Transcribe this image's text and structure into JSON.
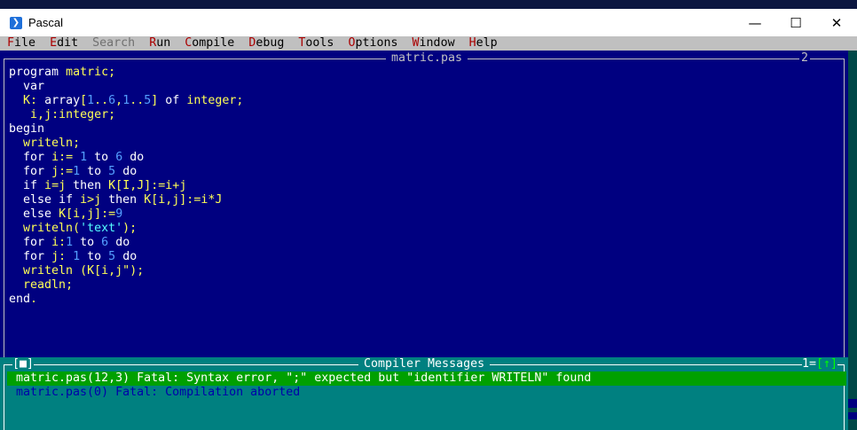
{
  "window": {
    "title": "Pascal",
    "controls": {
      "minimize": "—",
      "maximize": "☐",
      "close": "✕"
    }
  },
  "menu": [
    {
      "label": "File"
    },
    {
      "label": "Edit"
    },
    {
      "label": "Search",
      "disabled": true
    },
    {
      "label": "Run"
    },
    {
      "label": "Compile"
    },
    {
      "label": "Debug"
    },
    {
      "label": "Tools"
    },
    {
      "label": "Options"
    },
    {
      "label": "Window"
    },
    {
      "label": "Help"
    }
  ],
  "editor": {
    "filename": "matric.pas",
    "window_number": "2"
  },
  "code_lines": [
    "program matric;",
    "  var",
    "  K: array[1..6,1..5] of integer;",
    "   i,j:integer;",
    "begin",
    "  writeln;",
    "  for i:= 1 to 6 do",
    "  for j:=1 to 5 do",
    "  if i=j then K[I,J]:=i+j",
    "  else if i>j then K[i,j]:=i*J",
    "  else K[i,j]:=9",
    "  writeln('text');",
    "  for i:1 to 6 do",
    "  for j: 1 to 5 do",
    "  writeln (K[i,j\");",
    "  readln;",
    "end."
  ],
  "messages": {
    "title": "Compiler Messages",
    "close_box": "[■]",
    "window_number": "1",
    "zoom_box": "[↑]",
    "items": [
      {
        "text": "matric.pas(12,3) Fatal: Syntax error, \";\" expected but \"identifier WRITELN\" found",
        "selected": true
      },
      {
        "text": "matric.pas(0) Fatal: Compilation aborted",
        "selected": false
      }
    ]
  },
  "colors": {
    "editor_bg": "#000080",
    "messages_bg": "#008080",
    "selected_message_bg": "#00a000",
    "menubar_bg": "#c0c0c0",
    "hotkey": "#aa0000"
  }
}
